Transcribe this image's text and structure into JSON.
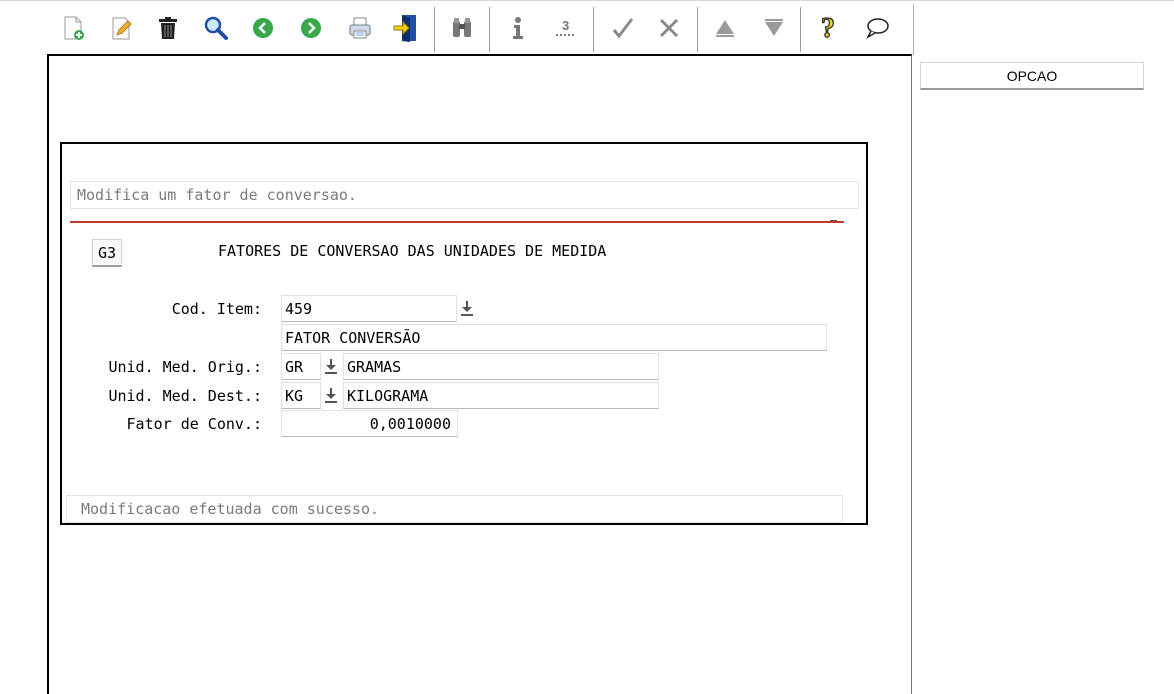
{
  "toolbar": {
    "icons": [
      "new-doc-icon",
      "edit-icon",
      "trash-icon",
      "search-icon",
      "prev-icon",
      "next-icon",
      "print-icon",
      "exit-icon",
      "binoculars-icon",
      "info-icon",
      "sum-icon",
      "confirm-icon",
      "cancel-icon",
      "up-icon",
      "down-icon",
      "help-icon",
      "chat-icon"
    ]
  },
  "side": {
    "opcao_label": "OPCAO"
  },
  "screen": {
    "hint": "Modifica um fator de conversao.",
    "code": "G3",
    "title": "FATORES DE CONVERSAO DAS UNIDADES DE MEDIDA",
    "status": "Modificacao efetuada com sucesso.",
    "fields": {
      "cod_item": {
        "label": "Cod. Item:",
        "value": "459",
        "description": "FATOR CONVERSÃO"
      },
      "unid_orig": {
        "label": "Unid. Med. Orig.:",
        "code": "GR",
        "description": "GRAMAS"
      },
      "unid_dest": {
        "label": "Unid. Med. Dest.:",
        "code": "KG",
        "description": "KILOGRAMA"
      },
      "fator": {
        "label": "Fator de Conv.:",
        "value": "0,0010000"
      }
    }
  },
  "colors": {
    "accent_red": "#c0392b",
    "green_nav": "#3aa84a",
    "help_yellow": "#f2d21b"
  }
}
